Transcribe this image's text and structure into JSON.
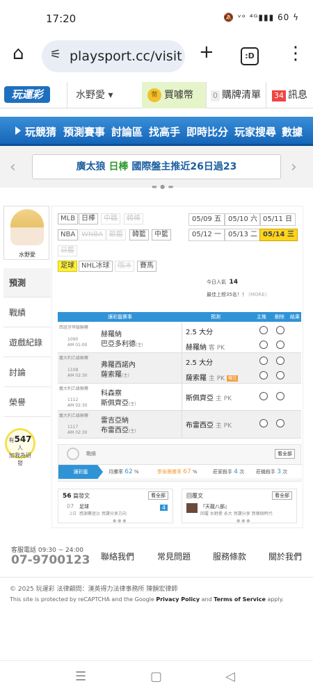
{
  "status": {
    "time": "17:20",
    "icons": "🔕 ᵛᵒ ⁴ᴳ▮▮▮ 60 ϟ"
  },
  "browser": {
    "url": "playsport.cc/visit",
    "new_tab": "+",
    "tabs": ":D",
    "menu": "⋮",
    "home": "⌂",
    "tune": "⚟"
  },
  "topnav": {
    "logo": "玩運彩",
    "user": "水野愛 ▾",
    "coin_icon": "幣",
    "buy": "買噱幣",
    "cart_count": "0",
    "cart": "購牌清單",
    "msg_count": "34",
    "msg": "訊息"
  },
  "mainnav": [
    "玩競猜",
    "預測賽事",
    "討論區",
    "找高手",
    "即時比分",
    "玩家搜尋",
    "數據"
  ],
  "marquee": {
    "part1": "廣太狼 ",
    "part2": "日棒",
    "part3": " 國際盤主推近26日過23"
  },
  "carousel": {
    "prev": "‹",
    "next": "›",
    "dots": "▬ ● ▬"
  },
  "profile": {
    "name": "水野愛"
  },
  "sidetabs": [
    "預測",
    "戰績",
    "遊戲紀錄",
    "討論",
    "榮譽"
  ],
  "bulb": {
    "pre": "有",
    "count": "547",
    "post": "人",
    "line2": "加我為研發"
  },
  "leagues": [
    {
      "label": "MLB",
      "state": "on"
    },
    {
      "label": "日棒",
      "state": "on"
    },
    {
      "label": "中職",
      "state": "dim"
    },
    {
      "label": "韓棒",
      "state": "dim"
    },
    {
      "label": "NBA",
      "state": "on"
    },
    {
      "label": "WNBA",
      "state": "dim"
    },
    {
      "label": "歐籃",
      "state": "dim"
    },
    {
      "label": "韓籃",
      "state": "on"
    },
    {
      "label": "中籃",
      "state": "on"
    },
    {
      "label": "日籃",
      "state": "dim"
    },
    {
      "label": "足球",
      "state": "sel"
    },
    {
      "label": "NHL冰球",
      "state": "on"
    },
    {
      "label": "俄冰",
      "state": "dim"
    },
    {
      "label": "賽馬",
      "state": "on"
    }
  ],
  "dates": [
    {
      "label": "05/09 五",
      "sel": false
    },
    {
      "label": "05/10 六",
      "sel": false
    },
    {
      "label": "05/11 日",
      "sel": false
    },
    {
      "label": "05/12 一",
      "sel": false
    },
    {
      "label": "05/13 二",
      "sel": false
    },
    {
      "label": "05/14 三",
      "sel": true
    }
  ],
  "stats": {
    "today_label": "今日人氣",
    "today": "14",
    "week": "最佳上榜35名！！",
    "week_hint": "(MORE)"
  },
  "table": {
    "head": {
      "event": "讓彩盤賽事",
      "pred": "預測",
      "main": "主推",
      "cancel": "刪除",
      "result": "結果"
    },
    "rows": [
      {
        "league": "西班牙甲級聯賽",
        "code": "1090",
        "time": "AM 01:00",
        "team1": "赫羅納",
        "team2": "巴亞多利德",
        "t2suffix": "(主)",
        "pick1": "2.5 大分",
        "pick2": "赫羅納",
        "pick2suffix": " 客 PK",
        "tag": ""
      },
      {
        "league": "義大利乙級聯賽",
        "code": "1108",
        "time": "AM 02:30",
        "team1": "弗羅西諾內",
        "team2": "薩索羅",
        "t2suffix": "(主)",
        "pick1": "2.5 大分",
        "pick2": "薩索羅",
        "pick2suffix": " 主 PK",
        "tag": "輸注"
      },
      {
        "league": "義大利乙級聯賽",
        "code": "1112",
        "time": "AM 02:30",
        "team1": "科森察",
        "team2": "斯佩齊亞",
        "t2suffix": "(主)",
        "pick1": "斯佩齊亞",
        "pick1suffix": " 主 PK",
        "pick2": "",
        "pick2suffix": "",
        "tag": ""
      },
      {
        "league": "義大利乙級聯賽",
        "code": "1117",
        "time": "AM 02:30",
        "team1": "雷吉亞納",
        "team2": "布雷西亞",
        "t2suffix": "(主)",
        "pick1": "布雷西亞",
        "pick1suffix": " 主 PK",
        "pick2": "",
        "pick2suffix": "",
        "tag": ""
      }
    ]
  },
  "performance": {
    "label": "戰績",
    "all": "看全部",
    "tab": "讓彩盤",
    "cells": [
      {
        "label": "月勝率 ",
        "value": "62",
        "unit": " %"
      },
      {
        "label": "季後賽勝率 ",
        "value": "67",
        "unit": " %"
      },
      {
        "label": "莊家殺手 ",
        "value": "4",
        "unit": " 次"
      },
      {
        "label": "莊機殺手 ",
        "value": "3",
        "unit": " 次"
      }
    ]
  },
  "posts": {
    "count": "56",
    "label": "篇發文",
    "all": "看全部",
    "date": "07",
    "sub": "2日",
    "title": "足球",
    "desc": "感謝賽迷沙 買讚分享方向",
    "reply": "4"
  },
  "replies": {
    "label": "回覆文",
    "all": "看全部",
    "title": "『天龍八部』",
    "desc": "回覆 水野愛 永大 買讚分享 買哪個時代"
  },
  "footer": {
    "tel_label": "客服電話 09:30 ~ 24:00",
    "tel": "07-9700123",
    "links": [
      "聯絡我們",
      "常見問題",
      "服務條款",
      "關於我們"
    ],
    "copy": "© 2025 玩運彩 法律顧問：漢英得力法律事務所 陳韻宏律師",
    "cap1": "This site is protected by reCAPTCHA and the Google ",
    "cap2": "Privacy Policy",
    "cap3": " and ",
    "cap4": "Terms of Service",
    "cap5": " apply."
  },
  "sysnav": {
    "recent": "☰",
    "home": "▢",
    "back": "◁"
  }
}
